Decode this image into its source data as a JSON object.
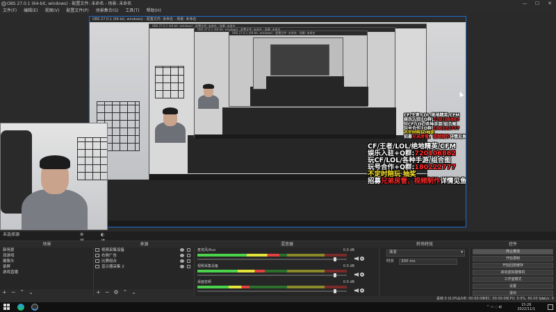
{
  "window": {
    "title": "OBS 27.0.1 (64-bit, windows) - 配置文件: 未命名 - 场景: 未命名"
  },
  "menu": [
    "文件(F)",
    "编辑(E)",
    "视图(V)",
    "配置文件(P)",
    "场景集合(S)",
    "工具(T)",
    "帮助(H)"
  ],
  "overlay": {
    "line1": "CF/王者/LOL/绝地精英/CFM",
    "line2a": "娱乐入驻+Q群:",
    "line2b": "720106862",
    "line3": "玩CF/LOL/各种手游/组合图",
    "line4a": "玩号合作+Q群:",
    "line4b": "180222777",
    "line5": "不定时陪玩 抽奖",
    "line6a": "招募",
    "line6b": "兄弟房管",
    "line6c": "，视频制作",
    "line6d": "详情见鱼吧"
  },
  "toolbar": {
    "no_source": "未选择源",
    "properties": "属性",
    "filters": "滤镜"
  },
  "panels": {
    "scenes": "场景",
    "sources": "来源",
    "mixer": "混音器",
    "transitions": "转场特效",
    "controls": "控件"
  },
  "scenes": [
    "新场景",
    "双游戏",
    "摄像头",
    "录屏",
    "游戏直播"
  ],
  "sources": [
    "视频采集设备",
    "右侧广告",
    "比赛组合",
    "显示器采集 2"
  ],
  "mixer": [
    {
      "name": "麦克风/Aux",
      "db": "0.0 dB",
      "level": 0.55,
      "vol": 0.92
    },
    {
      "name": "视频采集设备",
      "db": "0.0 dB",
      "level": 0.45,
      "vol": 0.92
    },
    {
      "name": "桌面音频",
      "db": "0.0 dB",
      "level": 0.35,
      "vol": 0.92
    }
  ],
  "transitions": {
    "type": "渐变",
    "duration_label": "时长",
    "duration_value": "300 ms"
  },
  "controls": [
    "停止推流",
    "开始录制",
    "开始回放缓存",
    "启动虚拟摄像机",
    "工作室模式",
    "设置",
    "退出"
  ],
  "status": {
    "drop": "丢帧 0 (0.0%)",
    "live": "LIVE: 00:00:00",
    "rec": "REC: 00:00:00",
    "cpu": "CPU: 0.0%, 60.00 fps",
    "bitrate": "kb/s: 0"
  },
  "clock": {
    "time": "15:26",
    "date": "2022/11/1"
  },
  "colors": {
    "accent": "#3d5e8a",
    "preview_border": "#1e6fd0"
  }
}
